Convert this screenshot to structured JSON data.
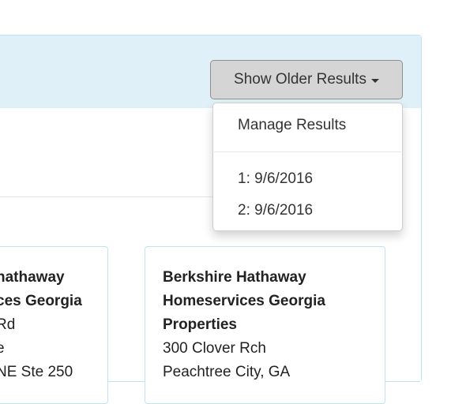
{
  "button": {
    "label": "Show Older Results"
  },
  "dropdown": {
    "items": [
      "Manage Results",
      "1: 9/6/2016",
      "2: 9/6/2016"
    ]
  },
  "cards": [
    {
      "name_lines": [
        "hathaway",
        "ces Georgia"
      ],
      "address_lines": [
        "Rd",
        "e",
        "NE Ste 250"
      ]
    },
    {
      "name_lines": [
        "Berkshire Hathaway",
        "Homeservices Georgia",
        "Properties"
      ],
      "address_lines": [
        "300 Clover Rch",
        "Peachtree City, GA"
      ]
    }
  ]
}
